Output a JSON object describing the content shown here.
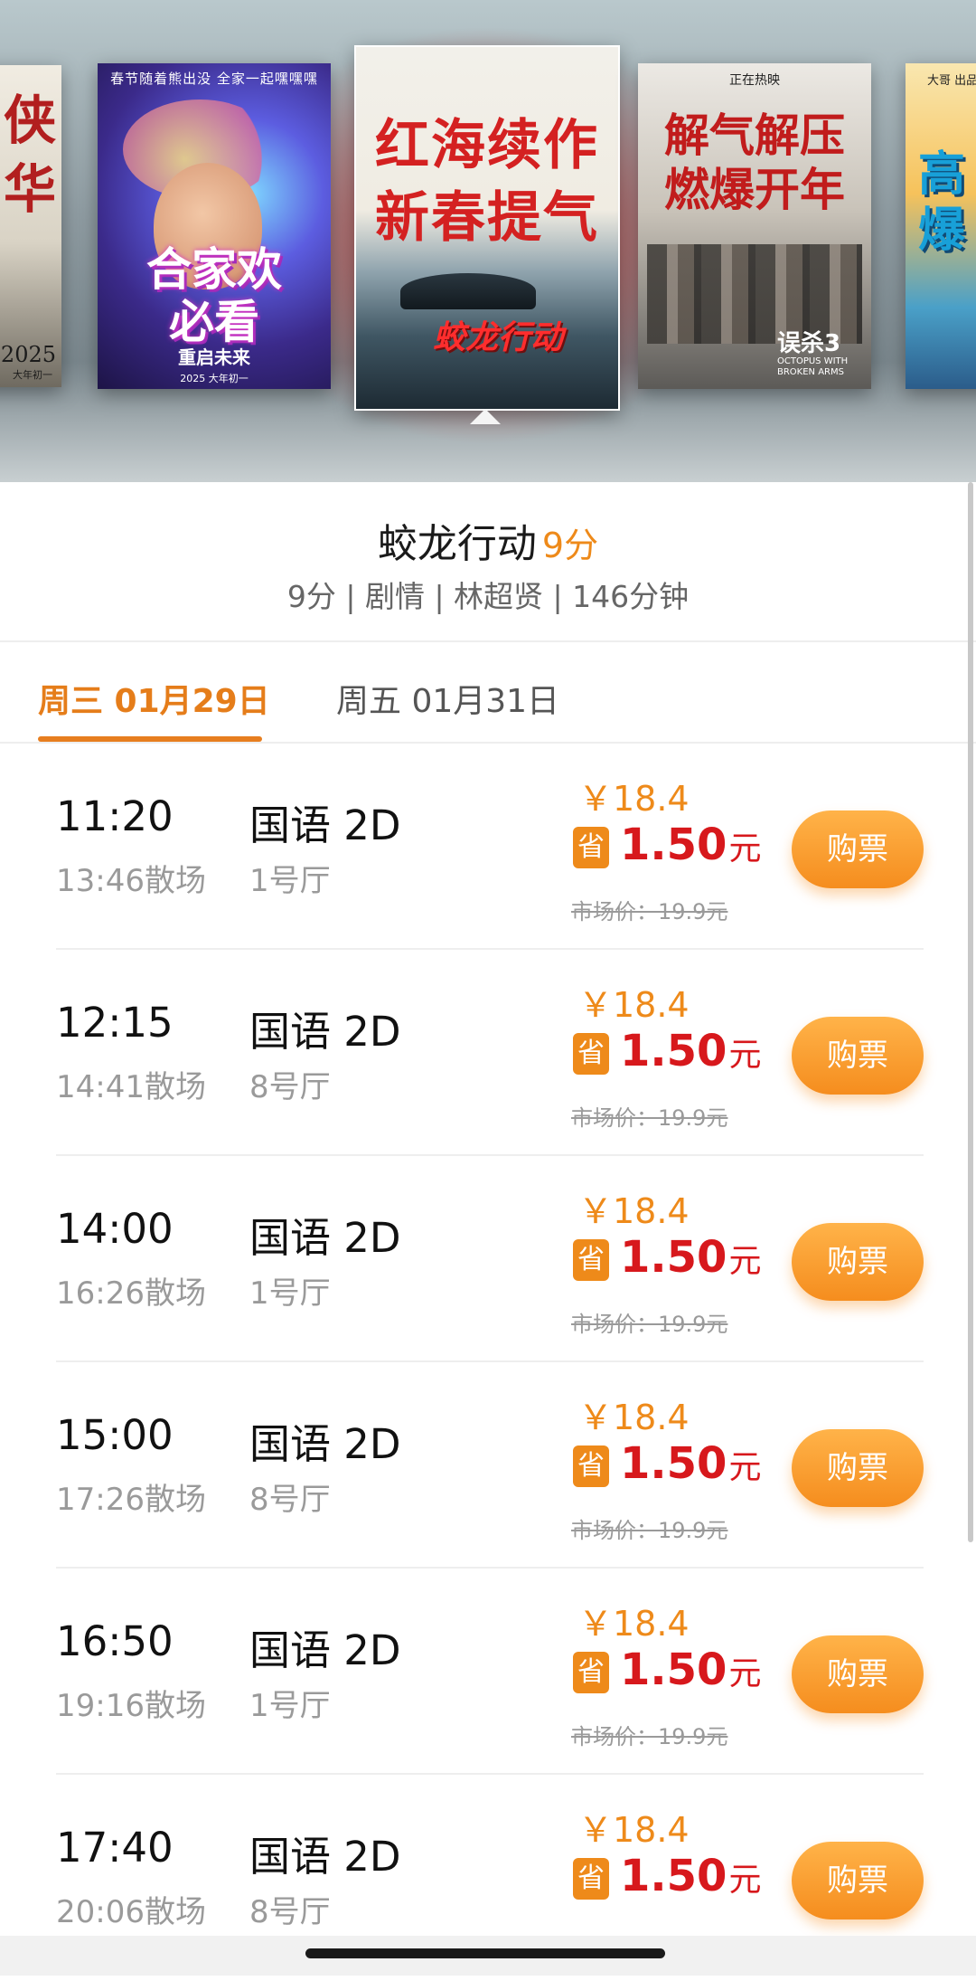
{
  "carousel": {
    "posters": [
      {
        "lines": [
          "侠",
          "华"
        ],
        "year": "2025",
        "year_note": "大年初一"
      },
      {
        "top_text": "春节随着熊出没 全家一起嘿嘿嘿",
        "title_lines": [
          "合家欢",
          "必看"
        ],
        "bottom_title": "重启未来",
        "bottom_note": "2025 大年初一"
      },
      {
        "title_lines": [
          "红海续作",
          "新春提气"
        ],
        "logo": "蛟龙行动"
      },
      {
        "top_text": "正在热映",
        "title_lines": [
          "解气解压",
          "燃爆开年"
        ],
        "logo_cn": "误杀3",
        "logo_en": "OCTOPUS WITH BROKEN ARMS"
      },
      {
        "top_text": "大哥 出品",
        "title_lines": [
          "高",
          "爆"
        ]
      }
    ]
  },
  "movie": {
    "title": "蛟龙行动",
    "score": "9分",
    "meta": "9分 | 剧情 | 林超贤 | 146分钟"
  },
  "date_tabs": [
    {
      "label": "周三 01月29日",
      "active": true
    },
    {
      "label": "周五 01月31日",
      "active": false
    }
  ],
  "showtimes": [
    {
      "start": "11:20",
      "end": "13:46散场",
      "lang": "国语 2D",
      "hall": "1号厅",
      "price": "￥18.4",
      "save_icon": "省",
      "save_amount": "1.50",
      "save_unit": "元",
      "market_price": "市场价：19.9元",
      "buy_label": "购票"
    },
    {
      "start": "12:15",
      "end": "14:41散场",
      "lang": "国语 2D",
      "hall": "8号厅",
      "price": "￥18.4",
      "save_icon": "省",
      "save_amount": "1.50",
      "save_unit": "元",
      "market_price": "市场价：19.9元",
      "buy_label": "购票"
    },
    {
      "start": "14:00",
      "end": "16:26散场",
      "lang": "国语 2D",
      "hall": "1号厅",
      "price": "￥18.4",
      "save_icon": "省",
      "save_amount": "1.50",
      "save_unit": "元",
      "market_price": "市场价：19.9元",
      "buy_label": "购票"
    },
    {
      "start": "15:00",
      "end": "17:26散场",
      "lang": "国语 2D",
      "hall": "8号厅",
      "price": "￥18.4",
      "save_icon": "省",
      "save_amount": "1.50",
      "save_unit": "元",
      "market_price": "市场价：19.9元",
      "buy_label": "购票"
    },
    {
      "start": "16:50",
      "end": "19:16散场",
      "lang": "国语 2D",
      "hall": "1号厅",
      "price": "￥18.4",
      "save_icon": "省",
      "save_amount": "1.50",
      "save_unit": "元",
      "market_price": "市场价：19.9元",
      "buy_label": "购票"
    },
    {
      "start": "17:40",
      "end": "20:06散场",
      "lang": "国语 2D",
      "hall": "8号厅",
      "price": "￥18.4",
      "save_icon": "省",
      "save_amount": "1.50",
      "save_unit": "元",
      "market_price": "",
      "buy_label": "购票"
    }
  ],
  "colors": {
    "accent": "#ee8a1a",
    "save_red": "#d7181c",
    "active_tab": "#e57d1a"
  }
}
